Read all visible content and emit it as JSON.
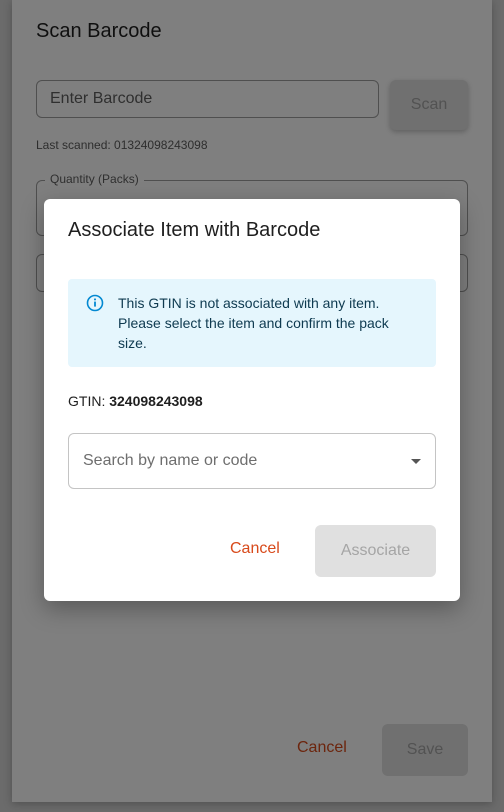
{
  "sheet": {
    "title": "Scan Barcode",
    "barcode_placeholder": "Enter Barcode",
    "scan_label": "Scan",
    "last_scanned": "Last scanned: 01324098243098",
    "quantity_label": "Quantity (Packs)",
    "cancel_label": "Cancel",
    "save_label": "Save"
  },
  "dialog": {
    "title": "Associate Item with Barcode",
    "alert_text": "This GTIN is not associated with any item. Please select the item and confirm the pack size.",
    "gtin_prefix": "GTIN:",
    "gtin_value": "324098243098",
    "search_placeholder": "Search by name or code",
    "cancel_label": "Cancel",
    "associate_label": "Associate",
    "icons": {
      "alert": "info-icon",
      "dropdown": "chevron-down-icon"
    }
  },
  "colors": {
    "accent_cancel": "#d84a1b",
    "alert_bg": "#e5f6fd",
    "alert_icon": "#0288d1",
    "disabled_bg": "#e0e0e0",
    "disabled_text": "#a5a5a5"
  }
}
